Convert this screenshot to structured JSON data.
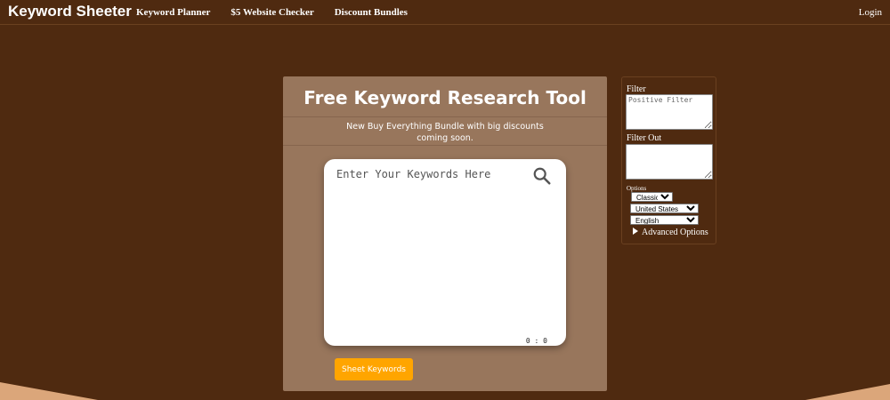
{
  "nav": {
    "brand": "Keyword Sheeter",
    "links": [
      "Keyword Planner",
      "$5 Website Checker",
      "Discount Bundles"
    ],
    "login": "Login"
  },
  "main": {
    "title": "Free Keyword Research Tool",
    "subtitle": "New Buy Everything Bundle with big discounts coming soon.",
    "keywords": {
      "placeholder": "Enter Your Keywords Here",
      "value": "",
      "counter": "0 : 0",
      "icon": "search-icon"
    },
    "sheet_button": "Sheet Keywords"
  },
  "side": {
    "filter_label": "Filter",
    "filter_placeholder": "Positive Filter",
    "filter_out_label": "Filter Out",
    "filter_out_placeholder": "",
    "options_label": "Options",
    "mode": "Classic",
    "country": "United States",
    "language": "English",
    "advanced_label": "Advanced Options"
  },
  "colors": {
    "background": "#4f2a10",
    "panel": "#98765c",
    "accent": "#ffa500",
    "wave": "#dba67a"
  }
}
